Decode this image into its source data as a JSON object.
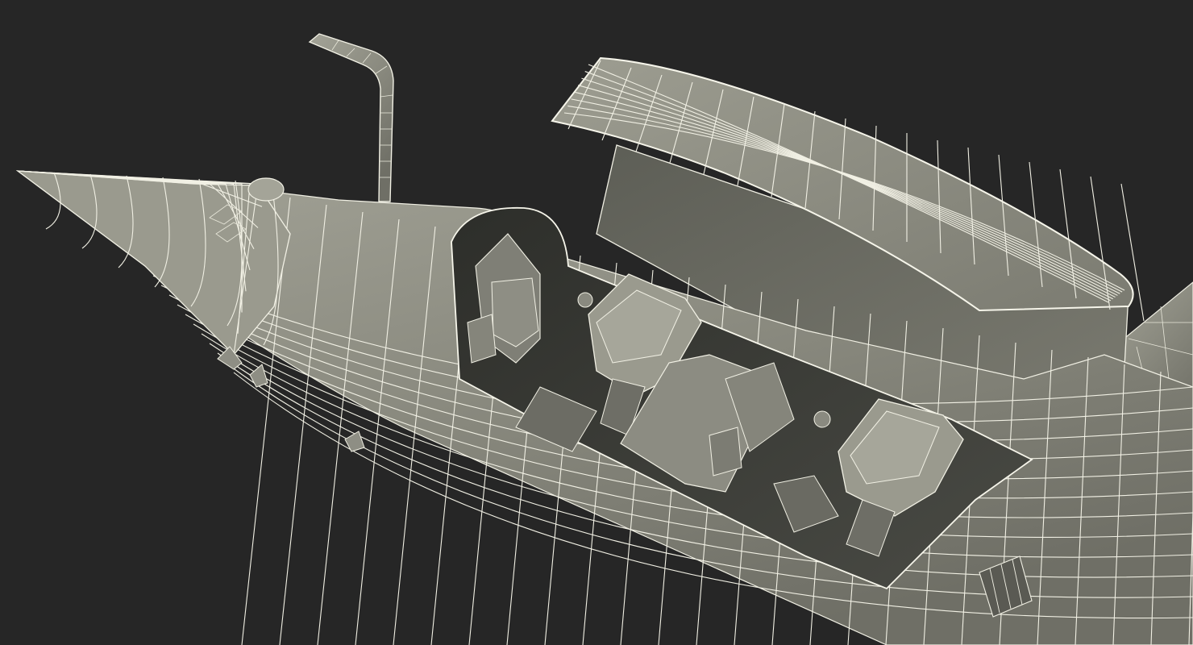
{
  "scene": {
    "background_color": "#262626",
    "surface_color": "#8c8c82",
    "shadow_color": "#3e3f3a",
    "wire_color": "#f1f0e4",
    "parts": [
      "nose-cone",
      "refueling-probe",
      "fuselage",
      "open-canopy",
      "front-cockpit",
      "front-ejection-seat",
      "rear-cockpit",
      "rear-ejection-seat",
      "wing-root"
    ]
  }
}
